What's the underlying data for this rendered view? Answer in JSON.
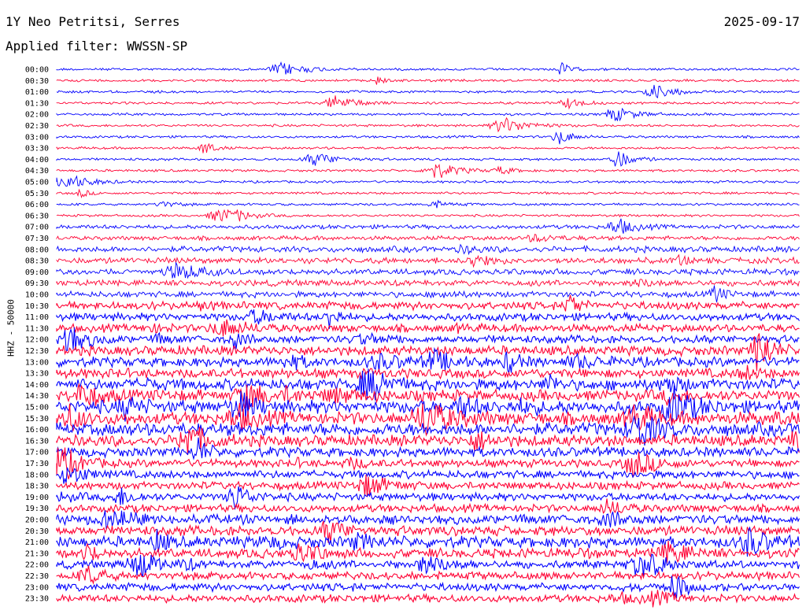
{
  "header": {
    "station": "1Y Neo Petritsi, Serres",
    "date": "2025-09-17",
    "filter": "Applied filter: WWSSN-SP"
  },
  "chart_data": {
    "type": "line",
    "title": "1Y Neo Petritsi, Serres",
    "ylabel": "HHZ - 50000",
    "row_labels": [
      "00:00",
      "00:30",
      "01:00",
      "01:30",
      "02:00",
      "02:30",
      "03:00",
      "03:30",
      "04:00",
      "04:30",
      "05:00",
      "05:30",
      "06:00",
      "06:30",
      "07:00",
      "07:30",
      "08:00",
      "08:30",
      "09:00",
      "09:30",
      "10:00",
      "10:30",
      "11:00",
      "11:30",
      "12:00",
      "12:30",
      "13:00",
      "13:30",
      "14:00",
      "14:30",
      "15:00",
      "15:30",
      "16:00",
      "16:30",
      "17:00",
      "17:30",
      "18:00",
      "18:30",
      "19:00",
      "19:30",
      "20:00",
      "20:30",
      "21:00",
      "21:30",
      "22:00",
      "22:30",
      "23:00",
      "23:30"
    ],
    "series_colors": [
      "#0000ff",
      "#ff0033"
    ],
    "noise_level": [
      1,
      1,
      1,
      1,
      1,
      1,
      1,
      1,
      1,
      1,
      1,
      1,
      1,
      1,
      2,
      2,
      3,
      3,
      3,
      3,
      3,
      4,
      4,
      4,
      4,
      5,
      5,
      5,
      6,
      6,
      7,
      7,
      7,
      6,
      5,
      4,
      4,
      4,
      4,
      4,
      5,
      5,
      6,
      5,
      4,
      4,
      4,
      4
    ]
  }
}
